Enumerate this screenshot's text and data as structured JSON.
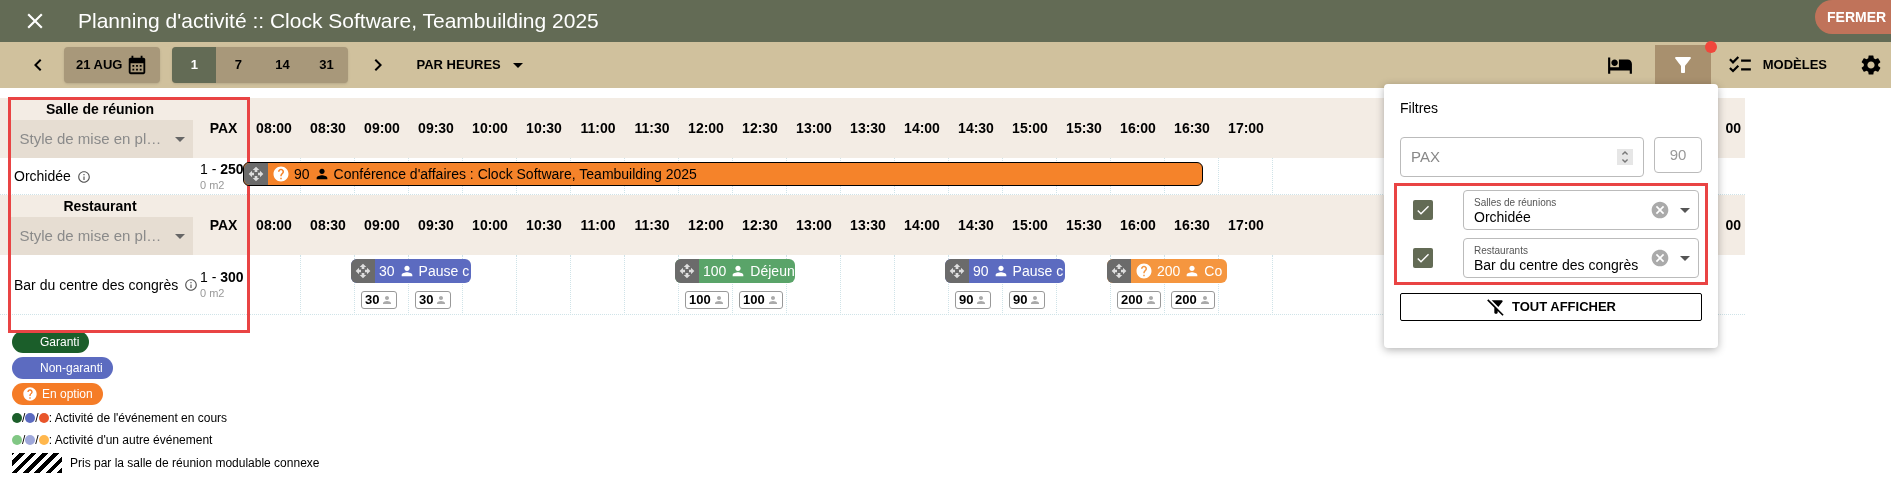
{
  "header": {
    "title": "Planning d'activité :: Clock Software, Teambuilding 2025",
    "close_button": "FERMER"
  },
  "toolbar": {
    "date": "21 AUG",
    "zoom_options": [
      {
        "label": "1",
        "selected": true
      },
      {
        "label": "7",
        "selected": false
      },
      {
        "label": "14",
        "selected": false
      },
      {
        "label": "31",
        "selected": false
      }
    ],
    "view_mode": "PAR HEURES",
    "filter_active": true,
    "templates": "MODÈLES"
  },
  "sections": [
    {
      "title": "Salle de réunion",
      "style_placeholder": "Style de mise en pl…",
      "pax_label": "PAX",
      "times": [
        "08:00",
        "08:30",
        "09:00",
        "09:30",
        "10:00",
        "10:30",
        "11:00",
        "11:30",
        "12:00",
        "12:30",
        "13:00",
        "13:30",
        "14:00",
        "14:30",
        "15:00",
        "15:30",
        "16:00",
        "16:30",
        "17:00"
      ],
      "cut_time": "00",
      "room": {
        "name": "Orchidée",
        "capacity": "1 - **250**",
        "area": "0 m2",
        "slots": [
          {
            "kind": "booked",
            "event": {
              "kind": "option",
              "color": "#f5832a",
              "pax": "90",
              "label": "Conférence d'affaires : Clock Software, Teambuilding 2025",
              "outlined": true
            }
          },
          {
            "kind": "booked"
          },
          {
            "kind": "booked"
          },
          {
            "kind": "booked"
          },
          {
            "kind": "booked"
          },
          {
            "kind": "booked"
          },
          {
            "kind": "booked"
          },
          {
            "kind": "booked"
          },
          {
            "kind": "booked"
          },
          {
            "kind": "booked"
          },
          {
            "kind": "booked"
          },
          {
            "kind": "booked"
          },
          {
            "kind": "booked"
          },
          {
            "kind": "booked"
          },
          {
            "kind": "booked"
          },
          {
            "kind": "booked"
          },
          {
            "kind": "booked"
          },
          {
            "kind": "booked"
          },
          {
            "kind": "free"
          }
        ]
      }
    },
    {
      "title": "Restaurant",
      "style_placeholder": "Style de mise en pl…",
      "pax_label": "PAX",
      "times": [
        "08:00",
        "08:30",
        "09:00",
        "09:30",
        "10:00",
        "10:30",
        "11:00",
        "11:30",
        "12:00",
        "12:30",
        "13:00",
        "13:30",
        "14:00",
        "14:30",
        "15:00",
        "15:30",
        "16:00",
        "16:30",
        "17:00"
      ],
      "cut_time": "00",
      "room": {
        "name": "Bar du centre des congrès",
        "capacity": "1 - **300**",
        "area": "0 m2",
        "slots": [
          {
            "kind": "free"
          },
          {
            "kind": "free"
          },
          {
            "kind": "booked",
            "chip": "30",
            "event": {
              "kind": "unconfirmed",
              "color": "#5c6bc0",
              "pax": "30",
              "label": "Pause c",
              "outlined": false
            }
          },
          {
            "kind": "booked",
            "chip": "30"
          },
          {
            "kind": "free"
          },
          {
            "kind": "free"
          },
          {
            "kind": "free"
          },
          {
            "kind": "free"
          },
          {
            "kind": "booked",
            "chip": "100",
            "event": {
              "kind": "confirmed",
              "color": "#5aa469",
              "pax": "100",
              "label": "Déjeun",
              "outlined": false
            }
          },
          {
            "kind": "booked",
            "chip": "100"
          },
          {
            "kind": "free"
          },
          {
            "kind": "free"
          },
          {
            "kind": "free"
          },
          {
            "kind": "booked",
            "chip": "90",
            "event": {
              "kind": "unconfirmed",
              "color": "#5c6bc0",
              "pax": "90",
              "label": "Pause c",
              "outlined": false
            }
          },
          {
            "kind": "booked",
            "chip": "90"
          },
          {
            "kind": "free"
          },
          {
            "kind": "booked",
            "chip": "200",
            "event": {
              "kind": "option",
              "color": "#f5963f",
              "pax": "200",
              "label": "Co",
              "outlined": false
            }
          },
          {
            "kind": "booked",
            "chip": "200"
          },
          {
            "kind": "free"
          }
        ]
      }
    }
  ],
  "filters": {
    "title": "Filtres",
    "pax_placeholder": "PAX",
    "pax_value": "90",
    "rows": [
      {
        "checked": true,
        "label": "Salles de réunions",
        "value": "Orchidée"
      },
      {
        "checked": true,
        "label": "Restaurants",
        "value": "Bar du centre des congrès"
      }
    ],
    "show_all": "TOUT AFFICHER"
  },
  "legend": {
    "statuses": [
      {
        "kind": "confirmed",
        "color": "#1b5e2a",
        "label": "Garanti"
      },
      {
        "kind": "unconfirmed",
        "color": "#5c6bc0",
        "label": "Non-garanti"
      },
      {
        "kind": "option",
        "color": "#f57c27",
        "label": "En option"
      }
    ],
    "dot_rows": [
      {
        "dots": [
          {
            "color": "#1b5e2a"
          },
          {
            "separator": "/",
            "color": "#5c6bc0"
          },
          {
            "separator": "/",
            "color": "#e8552a"
          }
        ],
        "label": ": Activité de l'événement en cours"
      },
      {
        "dots": [
          {
            "color": "#81c784"
          },
          {
            "separator": "/",
            "color": "#9fa8da"
          },
          {
            "separator": "/",
            "color": "#ffb74d"
          }
        ],
        "label": ": Activité d'un autre événement"
      }
    ],
    "hatch_label": "Pris par la salle de réunion modulable connexe"
  }
}
